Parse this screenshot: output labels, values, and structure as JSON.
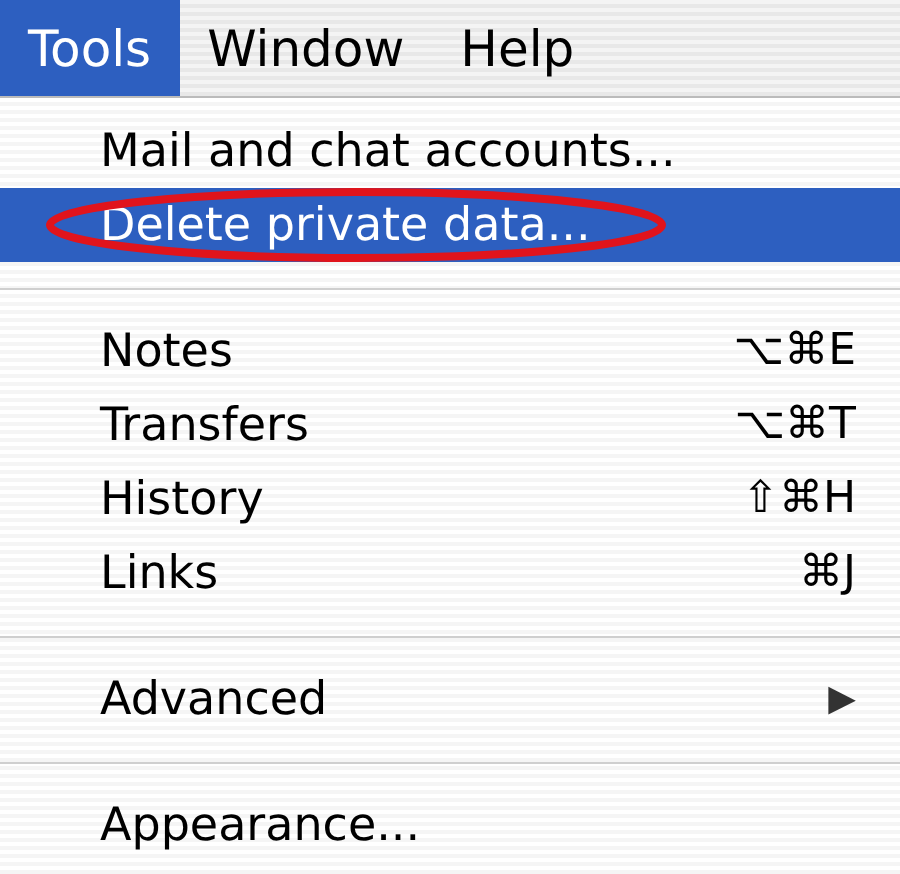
{
  "menu_bar": [
    {
      "label": "Tools",
      "selected": true
    },
    {
      "label": "Window",
      "selected": false
    },
    {
      "label": "Help",
      "selected": false
    }
  ],
  "menu": {
    "sections": [
      {
        "items": [
          {
            "kind": "command",
            "label": "Mail and chat accounts...",
            "selected": false,
            "circled": false
          },
          {
            "kind": "command",
            "label": "Delete private data...",
            "selected": true,
            "circled": true
          }
        ]
      },
      {
        "items": [
          {
            "kind": "command",
            "label": "Notes",
            "shortcut": "⌥⌘E",
            "selected": false,
            "circled": false
          },
          {
            "kind": "command",
            "label": "Transfers",
            "shortcut": "⌥⌘T",
            "selected": false,
            "circled": false
          },
          {
            "kind": "command",
            "label": "History",
            "shortcut": "⇧⌘H",
            "selected": false,
            "circled": false
          },
          {
            "kind": "command",
            "label": "Links",
            "shortcut": "⌘J",
            "selected": false,
            "circled": false
          }
        ]
      },
      {
        "items": [
          {
            "kind": "submenu",
            "label": "Advanced",
            "arrow": "▶",
            "selected": false,
            "circled": false
          }
        ]
      },
      {
        "items": [
          {
            "kind": "command",
            "label": "Appearance...",
            "selected": false,
            "circled": false
          }
        ]
      }
    ]
  }
}
